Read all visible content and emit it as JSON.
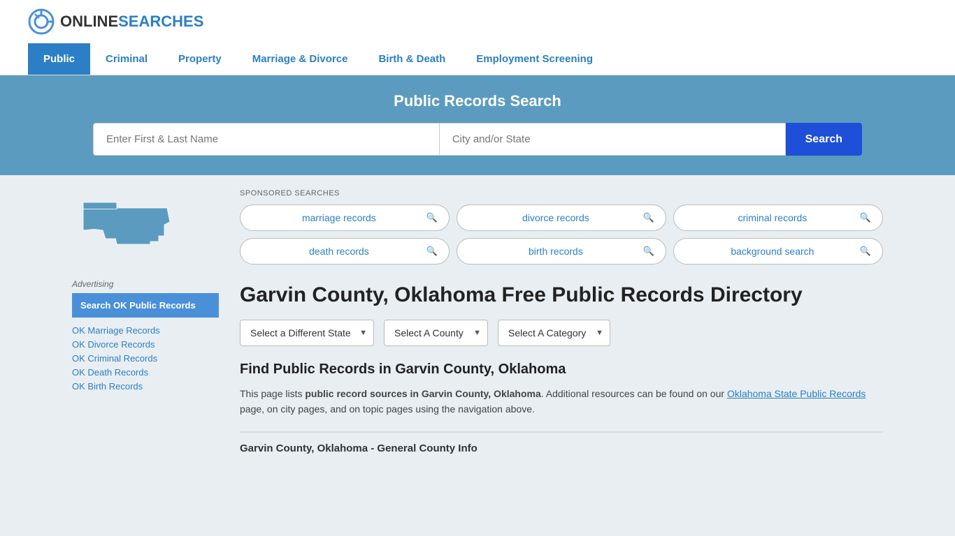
{
  "header": {
    "logo_online": "ONLINE",
    "logo_searches": "SEARCHES"
  },
  "nav": {
    "items": [
      {
        "label": "Public",
        "active": true
      },
      {
        "label": "Criminal",
        "active": false
      },
      {
        "label": "Property",
        "active": false
      },
      {
        "label": "Marriage & Divorce",
        "active": false
      },
      {
        "label": "Birth & Death",
        "active": false
      },
      {
        "label": "Employment Screening",
        "active": false
      }
    ]
  },
  "hero": {
    "title": "Public Records Search",
    "name_placeholder": "Enter First & Last Name",
    "city_placeholder": "City and/or State",
    "search_button": "Search"
  },
  "sponsored": {
    "label": "SPONSORED SEARCHES",
    "items": [
      {
        "label": "marriage records"
      },
      {
        "label": "divorce records"
      },
      {
        "label": "criminal records"
      },
      {
        "label": "death records"
      },
      {
        "label": "birth records"
      },
      {
        "label": "background search"
      }
    ]
  },
  "page": {
    "title": "Garvin County, Oklahoma Free Public Records Directory",
    "dropdowns": {
      "state": "Select a Different State",
      "county": "Select A County",
      "category": "Select A Category"
    },
    "find_title": "Find Public Records in Garvin County, Oklahoma",
    "find_text_1": "This page lists ",
    "find_bold": "public record sources in Garvin County, Oklahoma",
    "find_text_2": ". Additional resources can be found on our ",
    "find_link": "Oklahoma State Public Records",
    "find_text_3": " page, on city pages, and on topic pages using the navigation above.",
    "county_info_label": "Garvin County, Oklahoma - General County Info"
  },
  "sidebar": {
    "ad_label": "Advertising",
    "ad_box_text": "Search OK Public Records",
    "links": [
      {
        "label": "OK Marriage Records"
      },
      {
        "label": "OK Divorce Records"
      },
      {
        "label": "OK Criminal Records"
      },
      {
        "label": "OK Death Records"
      },
      {
        "label": "OK Birth Records"
      }
    ]
  }
}
